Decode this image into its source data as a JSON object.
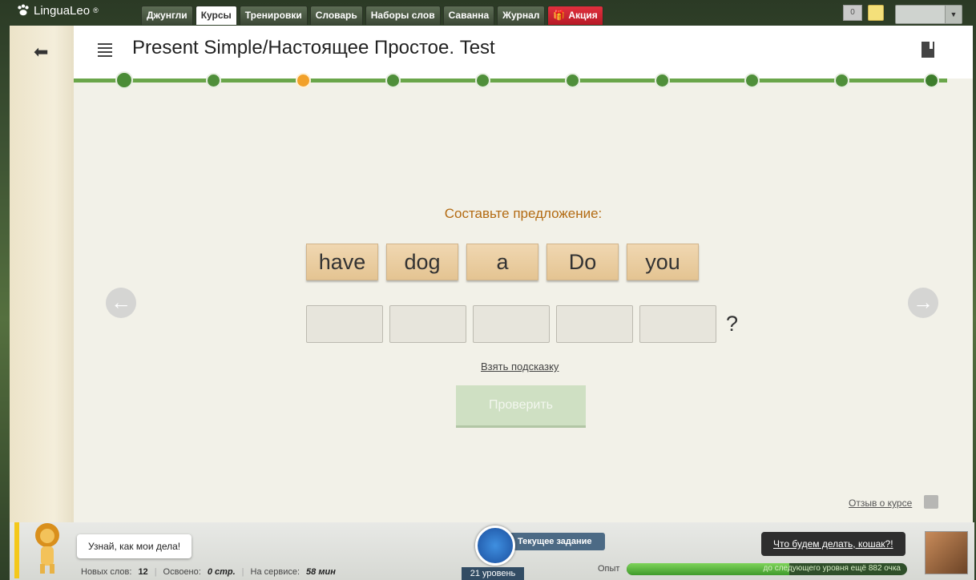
{
  "app": {
    "name": "LinguaLeo",
    "reg": "®"
  },
  "tabs": [
    {
      "label": "Джунгли",
      "active": false
    },
    {
      "label": "Курсы",
      "active": true
    },
    {
      "label": "Тренировки",
      "active": false
    },
    {
      "label": "Словарь",
      "active": false
    },
    {
      "label": "Наборы слов",
      "active": false
    },
    {
      "label": "Саванна",
      "active": false
    },
    {
      "label": "Журнал",
      "active": false
    },
    {
      "label": "Акция",
      "active": false
    }
  ],
  "topright": {
    "flag_count": "0"
  },
  "header": {
    "title": "Present Simple/Настоящее Простое. Test"
  },
  "progress": {
    "total_steps": 10,
    "current_step": 3
  },
  "exercise": {
    "prompt": "Составьте предложение:",
    "words": [
      "have",
      "dog",
      "a",
      "Do",
      "you"
    ],
    "answer_slots": 5,
    "punctuation": "?",
    "hint_label": "Взять подсказку",
    "check_label": "Проверить"
  },
  "feedback_label": "Отзыв о курсе",
  "bottom": {
    "lion_speech": "Узнай, как мои дела!",
    "stats": [
      {
        "label": "Новых слов:",
        "value": "12"
      },
      {
        "label": "Освоено:",
        "value": "0 стр."
      },
      {
        "label": "На сервисе:",
        "value": "58 мин"
      }
    ],
    "task_label": "Текущее задание",
    "level": "21 уровень",
    "xp_label": "Опыт",
    "xp_text": "до следующего уровня ещё 882 очка",
    "xp_fraction": 0.58,
    "right_speech": "Что будем делать, кошак?!"
  },
  "colors": {
    "accent_green": "#6aa64a",
    "prompt_orange": "#b36b13",
    "promo_red": "#c8212e"
  }
}
